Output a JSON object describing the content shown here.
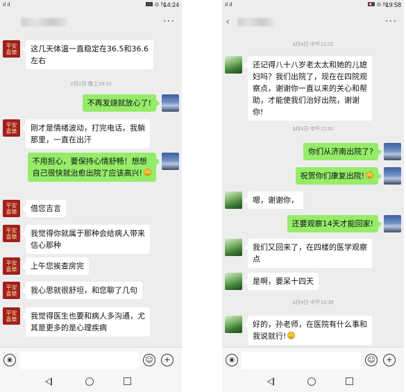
{
  "left": {
    "status": {
      "time": "14:24",
      "signal": "ıl ıl",
      "icons": "✱ ⊙ ℕ"
    },
    "messages": [
      {
        "dir": "in",
        "avatar": "red",
        "lines": [
          "这几天体温一直稳定在36.5和36.6",
          "左右"
        ]
      },
      {
        "type": "time",
        "text": "2月2日 晚上19:10"
      },
      {
        "dir": "out",
        "avatar": "sky",
        "lines": [
          "不再发烧就放心了!"
        ]
      },
      {
        "dir": "in",
        "avatar": "red",
        "lines": [
          "刚才是情绪波动，打完电话，我躺",
          "那里，一直在出汗"
        ]
      },
      {
        "dir": "out",
        "avatar": "sky",
        "lines": [
          "不用担心，要保持心情舒畅！想想",
          "自己很快就治愈出院了应该高兴!"
        ],
        "emoji": true
      },
      {
        "dir": "in",
        "avatar": "red",
        "lines": [
          "借您吉言"
        ]
      },
      {
        "dir": "in",
        "avatar": "red",
        "lines": [
          "我觉得你就属于那种会给病人带来",
          "信心那种"
        ]
      },
      {
        "dir": "in",
        "avatar": "red",
        "lines": [
          "上午您挨查房完"
        ]
      },
      {
        "dir": "in",
        "avatar": "red",
        "lines": [
          "我心思就很舒坦，和您聊了几句"
        ]
      },
      {
        "dir": "in",
        "avatar": "red",
        "lines": [
          "我觉得医生也要和病人多沟通，尤",
          "其是更多的是心理疾病"
        ]
      }
    ]
  },
  "right": {
    "status": {
      "time": "19:58",
      "signal": "ıl ıl",
      "icons": "✱ ⊙ ℕ"
    },
    "messages": [
      {
        "type": "time",
        "text": "3月4日 中午12:22"
      },
      {
        "dir": "in",
        "avatar": "leaf",
        "lines": [
          "还记得八十八岁老太太和她的儿媳",
          "妇吗？我们出院了，现在在四院观",
          "察点，谢谢你一直以来的关心和帮",
          "助，才能使我们治好出院，谢谢",
          "你!"
        ]
      },
      {
        "type": "time",
        "text": "3月4日 中午12:31"
      },
      {
        "dir": "out",
        "avatar": "sky",
        "lines": [
          "你们从济南出院了?"
        ]
      },
      {
        "dir": "out",
        "avatar": "sky",
        "lines": [
          "祝贺你们康复出院!"
        ],
        "emoji": true
      },
      {
        "dir": "in",
        "avatar": "leaf",
        "lines": [
          "嗯，谢谢你，"
        ]
      },
      {
        "dir": "out",
        "avatar": "sky",
        "lines": [
          "还要观察14天才能回家!"
        ]
      },
      {
        "dir": "in",
        "avatar": "leaf",
        "lines": [
          "我们又回来了，在四楼的医学观察",
          "点"
        ]
      },
      {
        "dir": "in",
        "avatar": "leaf",
        "lines": [
          "是啊，要呆十四天"
        ]
      },
      {
        "type": "time",
        "text": "3月4日 中午12:39"
      },
      {
        "dir": "in",
        "avatar": "leaf",
        "lines": [
          "好的，孙老师，在医院有什么事和",
          "我说就行!"
        ],
        "emoji": true
      }
    ]
  },
  "avatar_text": {
    "red_line1": "平安",
    "red_line2": "喜樂"
  },
  "ui": {
    "more": "···",
    "back": "‹",
    "voice": "◉",
    "emoji_btn": "☺",
    "plus": "+"
  },
  "colors": {
    "bubble_out": "#95ec69",
    "bubble_in": "#ffffff",
    "bg": "#ededed",
    "battery": "#e53935"
  }
}
